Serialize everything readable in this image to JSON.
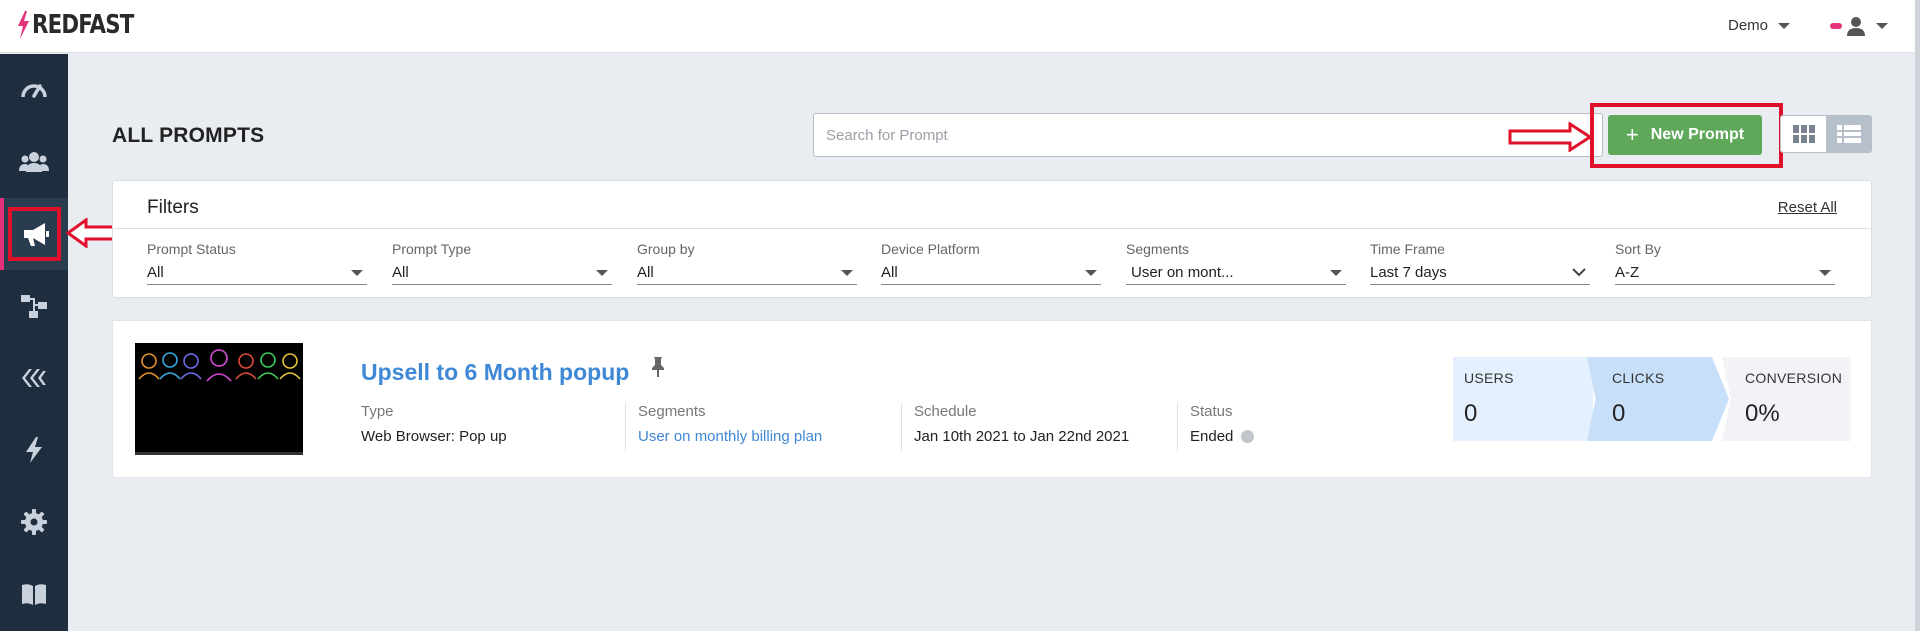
{
  "brand": {
    "name": "REDFAST"
  },
  "header": {
    "account_label": "Demo"
  },
  "sidebar": {
    "items": [
      {
        "icon": "dashboard-icon"
      },
      {
        "icon": "users-icon"
      },
      {
        "icon": "megaphone-icon",
        "active": true
      },
      {
        "icon": "flow-icon"
      },
      {
        "icon": "layers-icon"
      },
      {
        "icon": "bolt-icon"
      },
      {
        "icon": "gear-icon"
      },
      {
        "icon": "book-icon"
      }
    ]
  },
  "page": {
    "title": "ALL PROMPTS",
    "search_placeholder": "Search for Prompt",
    "new_prompt_label": "New Prompt"
  },
  "filters": {
    "title": "Filters",
    "reset_label": "Reset All",
    "fields": [
      {
        "label": "Prompt Status",
        "value": "All"
      },
      {
        "label": "Prompt Type",
        "value": "All"
      },
      {
        "label": "Group by",
        "value": "All"
      },
      {
        "label": "Device Platform",
        "value": "All"
      },
      {
        "label": "Segments",
        "value": "User on mont..."
      },
      {
        "label": "Time Frame",
        "value": "Last 7 days"
      },
      {
        "label": "Sort By",
        "value": "A-Z"
      }
    ]
  },
  "prompt": {
    "title": "Upsell to 6 Month popup",
    "type_label": "Type",
    "type_value": "Web Browser: Pop up",
    "segments_label": "Segments",
    "segments_value": "User on monthly billing plan",
    "schedule_label": "Schedule",
    "schedule_value": "Jan 10th 2021 to Jan 22nd 2021",
    "status_label": "Status",
    "status_value": "Ended",
    "stats": {
      "users_label": "USERS",
      "users_value": "0",
      "clicks_label": "CLICKS",
      "clicks_value": "0",
      "conversion_label": "CONVERSION",
      "conversion_value": "0%"
    }
  },
  "colors": {
    "brand_pink": "#e5307c",
    "sidebar_bg": "#1f2e3e",
    "primary_green": "#5fa85a",
    "link_blue": "#3f88d6",
    "annotation_red": "#e0102a"
  }
}
